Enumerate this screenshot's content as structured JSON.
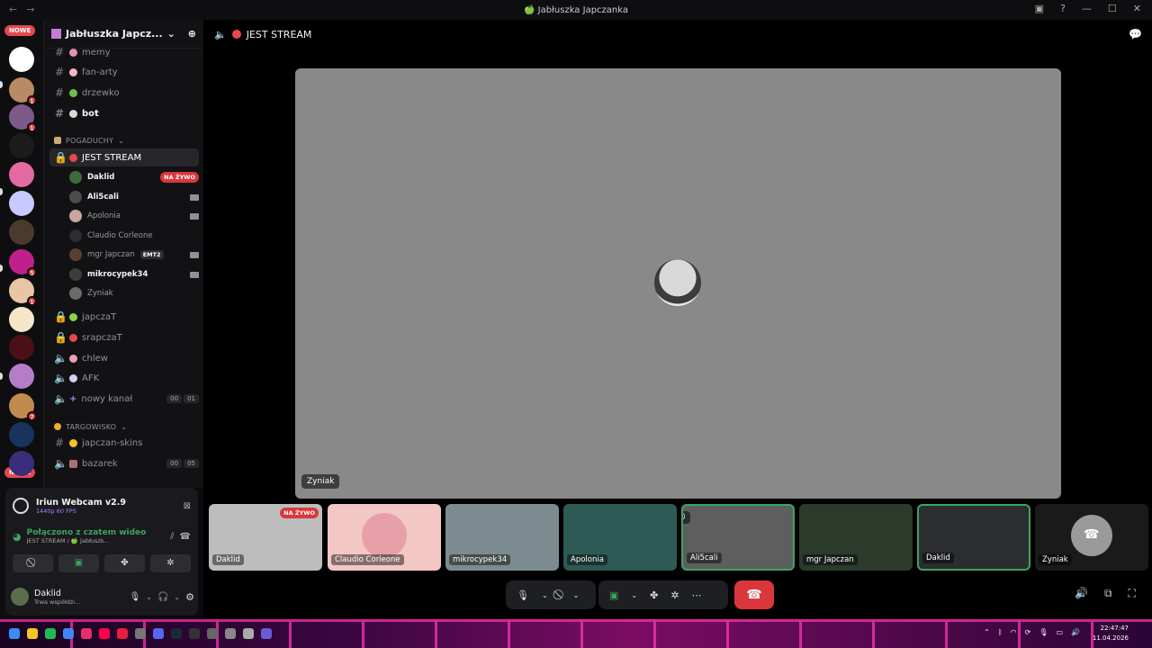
{
  "window": {
    "title": "🍏 Jabłuszka Japczanka"
  },
  "server": {
    "name": "Jabłuszka Japcz..."
  },
  "badges": {
    "nowe": "NOWE"
  },
  "server_rail": [
    {
      "name": "ideeft",
      "color": "#ffffff",
      "badge": ""
    },
    {
      "name": "server-2",
      "color": "#b98a63",
      "badge": "1"
    },
    {
      "name": "server-3",
      "color": "#7c5a8a",
      "badge": "1"
    },
    {
      "name": ".nx",
      "color": "#1b1b1b",
      "badge": ""
    },
    {
      "name": "server-5",
      "color": "#e36aa2",
      "badge": ""
    },
    {
      "name": "server-6",
      "color": "#c7c9ff",
      "badge": ""
    },
    {
      "name": "server-7",
      "color": "#4a3a2e",
      "badge": ""
    },
    {
      "name": "server-8",
      "color": "#c0208c",
      "badge": "5"
    },
    {
      "name": "server-9",
      "color": "#e8c5a6",
      "badge": "1"
    },
    {
      "name": "server-10",
      "color": "#f5e6c8",
      "badge": ""
    },
    {
      "name": "server-11",
      "color": "#4b0f18",
      "badge": ""
    },
    {
      "name": "server-12",
      "color": "#b57cc9",
      "badge": ""
    },
    {
      "name": "server-13",
      "color": "#c28b4e",
      "badge": "7"
    },
    {
      "name": "NEPTUN",
      "color": "#17345f",
      "badge": ""
    },
    {
      "name": "CITY",
      "color": "#3a2e7a",
      "badge": ""
    }
  ],
  "channels": {
    "memy": "memy",
    "fan_arty": "fan-arty",
    "drzewko": "drzewko",
    "bot": "bot",
    "cat_pogaduchy": "POGADUCHY",
    "jest_stream": "JEST STREAM",
    "japczat": "japczaT",
    "srapczat": "srapczaT",
    "chlew": "chlew",
    "afk": "AFK",
    "nowy_kanal": "nowy kanał",
    "nowy_kanal_counts": [
      "00",
      "01"
    ],
    "cat_targowisko": "TARGOWISKO",
    "japczan_skins": "japczan-skins",
    "bazarek": "bazarek",
    "bazarek_counts": [
      "00",
      "05"
    ]
  },
  "voice_users": [
    {
      "name": "Daklid",
      "live": "NA ŻYWO",
      "cam": false,
      "tag": "",
      "bright": true
    },
    {
      "name": "Ali5cali",
      "live": "",
      "cam": true,
      "tag": "",
      "bright": true
    },
    {
      "name": "Apolonia",
      "live": "",
      "cam": true,
      "tag": "",
      "bright": false
    },
    {
      "name": "Claudio Corleone",
      "live": "",
      "cam": false,
      "tag": "",
      "bright": false
    },
    {
      "name": "mgr Japczan",
      "live": "",
      "cam": true,
      "tag": "EMT2",
      "bright": false
    },
    {
      "name": "mikrocypek34",
      "live": "",
      "cam": true,
      "tag": "",
      "bright": true
    },
    {
      "name": "Zyniak",
      "live": "",
      "cam": false,
      "tag": "",
      "bright": false
    }
  ],
  "iriun": {
    "title": "Iriun Webcam v2.9",
    "sub": "1440p 60 FPS"
  },
  "voice_status": {
    "title": "Połączono z czatem wideo",
    "sub": "JEST STREAM / 🍏 Jabłuszk..."
  },
  "me": {
    "name": "Daklid",
    "status": "Trwa współdzi..."
  },
  "stage": {
    "channel": "JEST STREAM",
    "focused_user": "Zyniak"
  },
  "tiles": [
    {
      "name": "Daklid",
      "live": "NA ŻYWO",
      "bg": "#bdbdbd"
    },
    {
      "name": "Claudio Corleone",
      "live": "",
      "bg": "#f3c7c4"
    },
    {
      "name": "mikrocypek34",
      "live": "",
      "bg": "#7c8b8f"
    },
    {
      "name": "Apolonia",
      "live": "",
      "bg": "#2e5a56"
    },
    {
      "name": "Ali5cali",
      "live": "",
      "bg": "#5e5e5e"
    },
    {
      "name": "mgr Japczan",
      "live": "",
      "bg": "#2c3a2c"
    },
    {
      "name": "Daklid",
      "live": "",
      "bg": "#2b2d31"
    },
    {
      "name": "Zyniak",
      "live": "",
      "bg": "#1a1a1a"
    }
  ],
  "clock": {
    "time": "22:47:47",
    "date": "11.04.2026"
  }
}
